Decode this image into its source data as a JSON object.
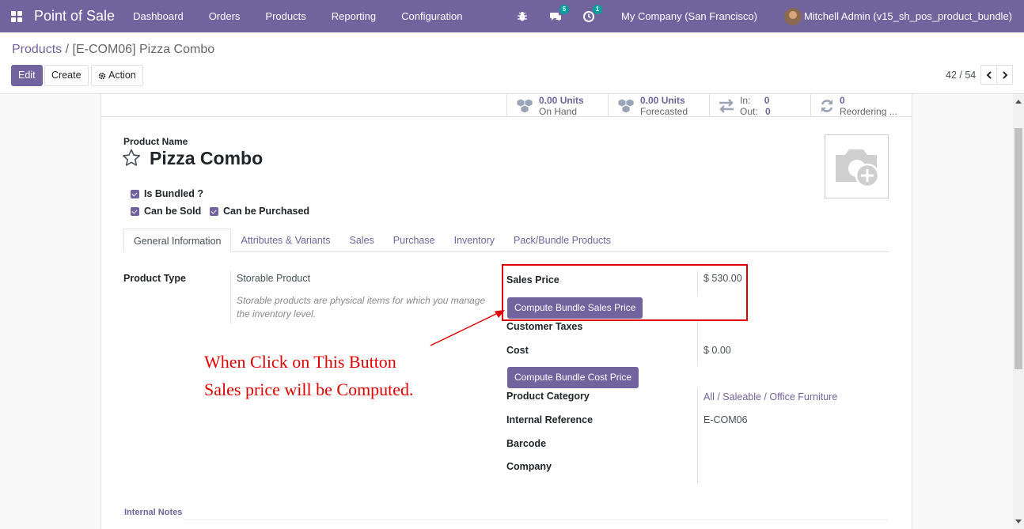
{
  "navbar": {
    "app_title": "Point of Sale",
    "menu": [
      "Dashboard",
      "Orders",
      "Products",
      "Reporting",
      "Configuration"
    ],
    "messages_count": "5",
    "activities_count": "1",
    "company": "My Company (San Francisco)",
    "user": "Mitchell Admin (v15_sh_pos_product_bundle)"
  },
  "breadcrumb": {
    "parent": "Products",
    "separator": "/",
    "current": "[E-COM06] Pizza Combo"
  },
  "toolbar": {
    "edit_label": "Edit",
    "create_label": "Create",
    "action_label": "Action"
  },
  "pager": {
    "text": "42 / 54"
  },
  "stat_buttons": [
    {
      "value": "0.00 Units",
      "label": "On Hand",
      "icon": "cubes-icon"
    },
    {
      "value": "0.00 Units",
      "label": "Forecasted",
      "icon": "cubes-icon"
    },
    {
      "in_label": "In:",
      "in_value": "0",
      "out_label": "Out:",
      "out_value": "0",
      "icon": "exchange-icon"
    },
    {
      "value": "0",
      "label": "Reordering ...",
      "icon": "refresh-icon"
    }
  ],
  "product": {
    "name_label": "Product Name",
    "name": "Pizza Combo",
    "checkboxes": {
      "is_bundled": "Is Bundled ?",
      "can_be_sold": "Can be Sold",
      "can_be_purchased": "Can be Purchased"
    }
  },
  "tabs": [
    "General Information",
    "Attributes & Variants",
    "Sales",
    "Purchase",
    "Inventory",
    "Pack/Bundle Products"
  ],
  "general": {
    "product_type_label": "Product Type",
    "product_type": "Storable Product",
    "product_type_help": "Storable products are physical items for which you manage the inventory level.",
    "sales_price_label": "Sales Price",
    "sales_price": "$ 530.00",
    "compute_sales_btn": "Compute Bundle Sales Price",
    "customer_taxes_label": "Customer Taxes",
    "cost_label": "Cost",
    "cost": "$ 0.00",
    "compute_cost_btn": "Compute Bundle Cost Price",
    "category_label": "Product Category",
    "category": "All / Saleable / Office Furniture",
    "internal_ref_label": "Internal Reference",
    "internal_ref": "E-COM06",
    "barcode_label": "Barcode",
    "company_label": "Company"
  },
  "annotation": {
    "line1": "When Click on This Button",
    "line2": "Sales price will be Computed.",
    "color": "#e10000"
  },
  "internal_notes_label": "Internal Notes",
  "colors": {
    "brand": "#71639e",
    "badge": "#00a09d"
  }
}
